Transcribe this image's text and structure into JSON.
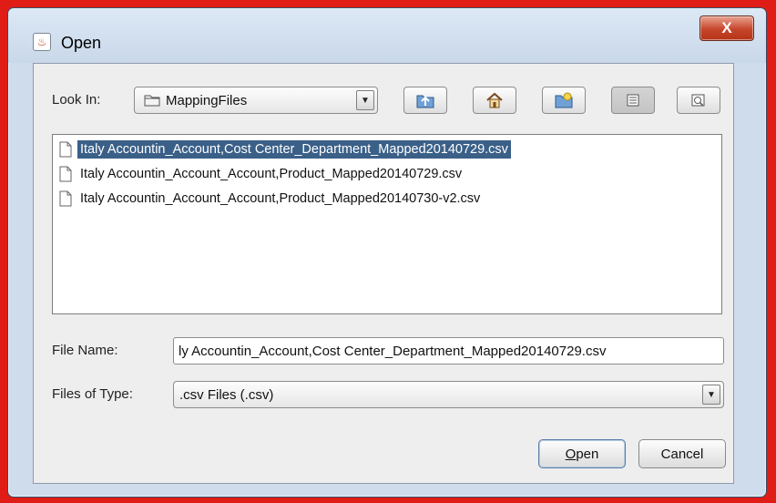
{
  "dialog": {
    "title": "Open",
    "close_label": "X",
    "app_icon_glyph": "♨"
  },
  "lookin": {
    "label": "Look In:",
    "value": "MappingFiles"
  },
  "toolbar": {
    "icons": [
      "up-one-level-icon",
      "home-icon",
      "new-folder-icon",
      "list-view-icon",
      "details-view-icon"
    ]
  },
  "files": [
    {
      "name": "Italy Accountin_Account,Cost Center_Department_Mapped20140729.csv",
      "selected": true
    },
    {
      "name": "Italy Accountin_Account_Account,Product_Mapped20140729.csv",
      "selected": false
    },
    {
      "name": "Italy Accountin_Account_Account,Product_Mapped20140730-v2.csv",
      "selected": false
    }
  ],
  "filename": {
    "label": "File Name:",
    "value": "ly Accountin_Account,Cost Center_Department_Mapped20140729.csv"
  },
  "filetype": {
    "label": "Files of Type:",
    "value": ".csv Files (.csv)"
  },
  "buttons": {
    "open_mnemonic": "O",
    "open_rest": "pen",
    "cancel": "Cancel"
  },
  "colors": {
    "selection": "#3b6088",
    "close_button": "#c6452b",
    "background_frame": "#e01c17"
  }
}
